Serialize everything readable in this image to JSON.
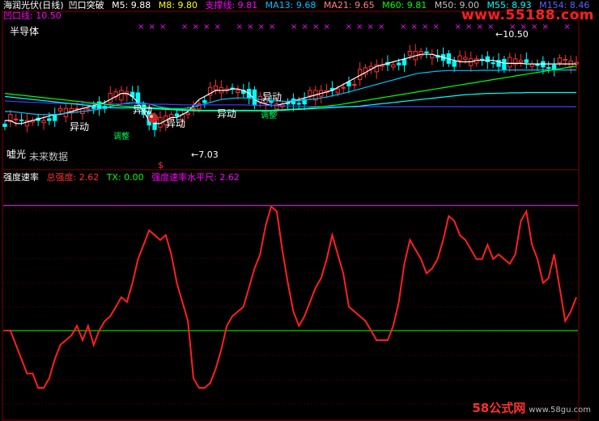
{
  "header": {
    "stock_name": "海润光伏(日线)",
    "indicator_name": "凹口突破",
    "items": [
      {
        "label": "M5: 9.88",
        "color": "#ffffff"
      },
      {
        "label": "M8: 9.80",
        "color": "#ffff00"
      },
      {
        "label": "支撑线: 9.81",
        "color": "#ff00ff"
      },
      {
        "label": "MA13: 9.68",
        "color": "#00c0ff"
      },
      {
        "label": "MA21: 9.65",
        "color": "#ff8080"
      },
      {
        "label": "M60: 9.81",
        "color": "#00ff00"
      },
      {
        "label": "M50: 9.00",
        "color": "#c0c0c0"
      },
      {
        "label": "M55: 8.93",
        "color": "#00ffff"
      },
      {
        "label": "M154: 8.46",
        "color": "#6060ff"
      }
    ]
  },
  "sub_header": {
    "label": "凹口线: 10.50",
    "sector": "半导体"
  },
  "upper_annotations": {
    "yidong": "异动",
    "yidong_big": "异动",
    "lower_label": "嘘光",
    "no_data": "未来数据",
    "price_low": "←7.03",
    "price_high": "←10.50",
    "dollar": "$",
    "tiaozhan": "调整",
    "cross": "×"
  },
  "lower_header": {
    "name": "强度速率",
    "items": [
      {
        "label": "总强度: 2.62",
        "color": "#ff3030"
      },
      {
        "label": "TX: 0.00",
        "color": "#00ff00"
      },
      {
        "label": "强度速率水平尺: 2.62",
        "color": "#ff00ff"
      }
    ]
  },
  "watermark": {
    "top": "www.55188.com",
    "bottom_brand": "58公式网",
    "bottom_url": "www.58gu.com"
  },
  "chart_data": [
    {
      "type": "line",
      "name": "upper-price-panel",
      "x_count": 104,
      "ylim": [
        6.5,
        11.2
      ],
      "annotations": {
        "low_price": 7.03,
        "high_price": 10.5
      },
      "series": [
        {
          "name": "M5",
          "color": "#ffffff",
          "values": [
            8.0,
            8.0,
            7.9,
            7.9,
            7.95,
            8.0,
            8.05,
            8.1,
            8.15,
            8.2,
            8.2,
            8.25,
            8.3,
            8.35,
            8.4,
            8.45,
            8.5,
            8.55,
            8.6,
            8.7,
            8.8,
            8.9,
            8.9,
            8.8,
            8.6,
            8.3,
            8.0,
            7.9,
            7.9,
            8.0,
            8.1,
            8.1,
            8.2,
            8.3,
            8.5,
            8.7,
            8.8,
            8.9,
            9.0,
            9.0,
            9.0,
            9.05,
            9.05,
            9.0,
            8.9,
            8.7,
            8.6,
            8.55,
            8.5,
            8.5,
            8.55,
            8.6,
            8.65,
            8.7,
            8.75,
            8.8,
            8.85,
            8.9,
            8.95,
            9.0,
            9.1,
            9.2,
            9.3,
            9.4,
            9.5,
            9.6,
            9.7,
            9.8,
            9.85,
            9.9,
            9.95,
            10.0,
            10.05,
            10.1,
            10.15,
            10.2,
            10.2,
            10.2,
            10.15,
            10.1,
            10.05,
            10.0,
            9.95,
            9.95,
            9.95,
            10.0,
            10.0,
            10.0,
            10.0,
            9.95,
            9.9,
            9.9,
            9.9,
            9.9,
            9.88,
            9.88,
            9.88,
            9.88,
            9.88,
            9.88,
            9.88,
            9.88,
            9.88,
            9.88
          ]
        },
        {
          "name": "MA13",
          "color": "#00c0ff",
          "values": [
            8.3,
            8.3,
            8.28,
            8.26,
            8.24,
            8.22,
            8.2,
            8.2,
            8.2,
            8.2,
            8.22,
            8.24,
            8.26,
            8.28,
            8.3,
            8.32,
            8.35,
            8.38,
            8.42,
            8.46,
            8.5,
            8.55,
            8.58,
            8.6,
            8.6,
            8.58,
            8.55,
            8.5,
            8.45,
            8.42,
            8.4,
            8.4,
            8.4,
            8.42,
            8.45,
            8.5,
            8.55,
            8.6,
            8.65,
            8.7,
            8.72,
            8.74,
            8.75,
            8.75,
            8.74,
            8.72,
            8.7,
            8.68,
            8.66,
            8.65,
            8.64,
            8.64,
            8.65,
            8.66,
            8.68,
            8.7,
            8.72,
            8.75,
            8.78,
            8.82,
            8.86,
            8.9,
            8.95,
            9.0,
            9.05,
            9.1,
            9.15,
            9.2,
            9.25,
            9.3,
            9.35,
            9.4,
            9.45,
            9.5,
            9.55,
            9.58,
            9.6,
            9.62,
            9.64,
            9.65,
            9.66,
            9.66,
            9.66,
            9.66,
            9.66,
            9.66,
            9.67,
            9.67,
            9.67,
            9.67,
            9.68,
            9.68,
            9.68,
            9.68,
            9.68,
            9.68,
            9.68,
            9.68,
            9.68,
            9.68,
            9.68,
            9.68,
            9.68,
            9.68
          ]
        },
        {
          "name": "M154",
          "color": "#4040ff",
          "values": [
            8.65,
            8.64,
            8.63,
            8.62,
            8.61,
            8.6,
            8.6,
            8.59,
            8.58,
            8.58,
            8.57,
            8.57,
            8.56,
            8.56,
            8.56,
            8.55,
            8.55,
            8.55,
            8.55,
            8.55,
            8.55,
            8.55,
            8.55,
            8.55,
            8.55,
            8.55,
            8.55,
            8.54,
            8.54,
            8.54,
            8.53,
            8.53,
            8.52,
            8.52,
            8.52,
            8.52,
            8.52,
            8.52,
            8.52,
            8.52,
            8.52,
            8.52,
            8.52,
            8.52,
            8.51,
            8.51,
            8.5,
            8.5,
            8.5,
            8.49,
            8.49,
            8.48,
            8.48,
            8.48,
            8.47,
            8.47,
            8.47,
            8.46,
            8.46,
            8.46,
            8.46,
            8.46,
            8.46,
            8.46,
            8.46,
            8.46,
            8.46,
            8.46,
            8.46,
            8.46,
            8.46,
            8.46,
            8.46,
            8.46,
            8.46,
            8.46,
            8.46,
            8.46,
            8.46,
            8.46,
            8.46,
            8.46,
            8.46,
            8.46,
            8.46,
            8.46,
            8.46,
            8.46,
            8.46,
            8.46,
            8.46,
            8.46,
            8.46,
            8.46,
            8.46,
            8.46,
            8.46,
            8.46,
            8.46,
            8.46,
            8.46,
            8.46,
            8.46,
            8.46
          ]
        },
        {
          "name": "M60",
          "color": "#00ff00",
          "values": [
            8.9,
            8.88,
            8.86,
            8.84,
            8.82,
            8.8,
            8.78,
            8.76,
            8.74,
            8.72,
            8.7,
            8.68,
            8.66,
            8.64,
            8.62,
            8.6,
            8.58,
            8.56,
            8.54,
            8.52,
            8.5,
            8.48,
            8.47,
            8.46,
            8.45,
            8.44,
            8.43,
            8.42,
            8.41,
            8.4,
            8.39,
            8.38,
            8.37,
            8.36,
            8.35,
            8.34,
            8.34,
            8.34,
            8.34,
            8.34,
            8.34,
            8.34,
            8.34,
            8.34,
            8.34,
            8.34,
            8.34,
            8.34,
            8.34,
            8.35,
            8.36,
            8.37,
            8.38,
            8.39,
            8.4,
            8.42,
            8.44,
            8.46,
            8.48,
            8.5,
            8.52,
            8.55,
            8.58,
            8.61,
            8.64,
            8.67,
            8.7,
            8.73,
            8.76,
            8.79,
            8.82,
            8.85,
            8.88,
            8.91,
            8.94,
            8.97,
            9.0,
            9.03,
            9.06,
            9.09,
            9.12,
            9.15,
            9.18,
            9.21,
            9.24,
            9.27,
            9.3,
            9.33,
            9.36,
            9.39,
            9.42,
            9.45,
            9.48,
            9.51,
            9.54,
            9.57,
            9.6,
            9.63,
            9.66,
            9.69,
            9.72,
            9.75,
            9.78,
            9.81
          ]
        },
        {
          "name": "M55",
          "color": "#00ffff",
          "values": [
            8.8,
            8.78,
            8.76,
            8.74,
            8.72,
            8.7,
            8.68,
            8.66,
            8.64,
            8.62,
            8.6,
            8.58,
            8.56,
            8.54,
            8.52,
            8.5,
            8.48,
            8.46,
            8.44,
            8.43,
            8.42,
            8.42,
            8.42,
            8.42,
            8.42,
            8.41,
            8.4,
            8.39,
            8.38,
            8.37,
            8.36,
            8.35,
            8.34,
            8.33,
            8.32,
            8.32,
            8.32,
            8.32,
            8.32,
            8.32,
            8.32,
            8.32,
            8.32,
            8.32,
            8.32,
            8.32,
            8.32,
            8.32,
            8.32,
            8.33,
            8.34,
            8.35,
            8.36,
            8.37,
            8.38,
            8.39,
            8.4,
            8.41,
            8.42,
            8.43,
            8.44,
            8.45,
            8.46,
            8.47,
            8.48,
            8.5,
            8.52,
            8.54,
            8.56,
            8.58,
            8.6,
            8.62,
            8.64,
            8.66,
            8.68,
            8.7,
            8.72,
            8.74,
            8.76,
            8.78,
            8.8,
            8.82,
            8.84,
            8.86,
            8.87,
            8.88,
            8.89,
            8.9,
            8.9,
            8.91,
            8.91,
            8.92,
            8.92,
            8.92,
            8.93,
            8.93,
            8.93,
            8.93,
            8.93,
            8.93,
            8.93,
            8.93,
            8.93,
            8.93
          ]
        }
      ]
    },
    {
      "type": "line",
      "name": "strength-rate-panel",
      "x_count": 104,
      "ylim": [
        -1.2,
        3.0
      ],
      "series": [
        {
          "name": "总强度",
          "color": "#ff2020",
          "values": [
            0.0,
            0.0,
            -0.3,
            -0.6,
            -0.9,
            -0.9,
            -1.2,
            -1.2,
            -1.0,
            -0.6,
            -0.3,
            -0.2,
            -0.1,
            0.1,
            -0.2,
            0.1,
            -0.3,
            0.0,
            0.2,
            0.3,
            0.5,
            0.7,
            0.6,
            1.0,
            1.5,
            1.8,
            2.1,
            2.0,
            1.9,
            2.0,
            1.6,
            1.0,
            0.6,
            0.2,
            -1.0,
            -1.2,
            -1.2,
            -1.1,
            -0.8,
            -0.4,
            0.1,
            0.3,
            0.4,
            0.5,
            0.9,
            1.3,
            1.6,
            2.2,
            2.6,
            2.5,
            1.7,
            1.0,
            0.4,
            0.1,
            0.3,
            0.6,
            0.9,
            1.1,
            1.5,
            2.0,
            1.6,
            1.2,
            0.5,
            0.4,
            0.3,
            0.2,
            0.0,
            -0.2,
            -0.2,
            -0.2,
            0.1,
            0.6,
            1.4,
            1.9,
            1.7,
            1.5,
            1.2,
            1.3,
            1.5,
            1.9,
            2.4,
            2.3,
            2.0,
            1.9,
            1.7,
            1.5,
            1.5,
            1.8,
            1.5,
            1.6,
            1.5,
            1.4,
            1.6,
            2.3,
            2.5,
            1.8,
            1.5,
            1.0,
            1.1,
            1.6,
            0.9,
            0.2,
            0.4,
            0.7
          ]
        },
        {
          "name": "TX",
          "color": "#00ff00",
          "values": [
            0.0
          ]
        },
        {
          "name": "强度速率水平尺",
          "color": "#ff00ff",
          "values": [
            2.62
          ]
        }
      ]
    }
  ]
}
